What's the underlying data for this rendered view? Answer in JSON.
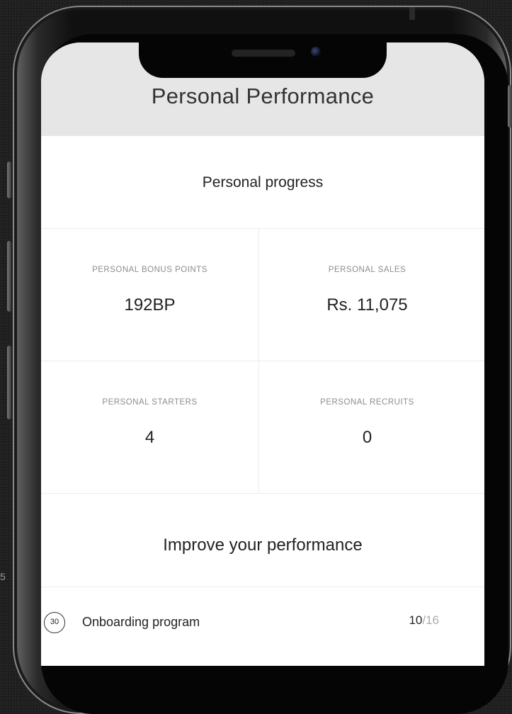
{
  "header": {
    "title": "Personal Performance"
  },
  "progress": {
    "title": "Personal progress",
    "stats": [
      {
        "label": "PERSONAL BONUS POINTS",
        "value": "192BP"
      },
      {
        "label": "PERSONAL SALES",
        "value": "Rs. 11,075"
      },
      {
        "label": "PERSONAL STARTERS",
        "value": "4"
      },
      {
        "label": "PERSONAL RECRUITS",
        "value": "0"
      }
    ]
  },
  "improve": {
    "title": "Improve your performance",
    "program": {
      "badge": "30",
      "name": "Onboarding program",
      "done": "10",
      "total": "/16"
    }
  },
  "stray": {
    "text": "5"
  }
}
